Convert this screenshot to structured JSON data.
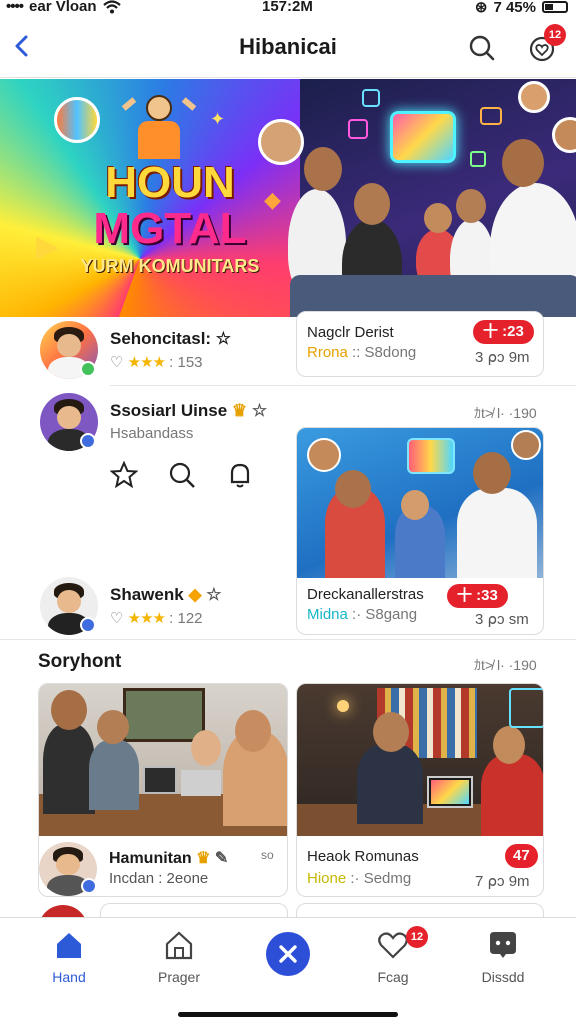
{
  "status_bar": {
    "carrier": "ear Vloan",
    "time": "157:2M",
    "battery": "7 45%"
  },
  "header": {
    "title": "Hibanicai",
    "notification_count": "12"
  },
  "hero": {
    "line1": "HOUN",
    "line2": "MGTAL",
    "line3": "YURM KOMUNITARS"
  },
  "feed": {
    "row1": {
      "name": "Sehoncitasl: ☆",
      "rating_stars": "★★★",
      "rating_value": ": 153",
      "card": {
        "title": "Nagclr Derist",
        "highlight": "Rrona",
        "rest": ":: S8dong",
        "pill": "十 :23",
        "meta": "3 ⍴ɔ 9m"
      }
    },
    "row2": {
      "name": "Ssosiarl Uinse",
      "subtitle": "Hsabandass",
      "time": "ｶt≯ l· ·190",
      "card": {
        "title": "Dreckanallerstras",
        "highlight": "Midna",
        "rest": ":· S8gang",
        "pill": "十 :33",
        "meta": "3 ⍴ɔ ѕm"
      }
    },
    "row3": {
      "name": "Shawenk",
      "rating_stars": "★★★",
      "rating_value": ": 122"
    },
    "section": {
      "title": "Soryhont",
      "time": "ｶt≯ l· ·190"
    },
    "row4": {
      "name": "Hamunitan",
      "extra": "so",
      "subtitle": "Incdan : 2eone",
      "card": {
        "title": "Heaok Romunas",
        "highlight": "Hione",
        "rest": ":· Sedmg",
        "pill": "47",
        "meta": "7 ⍴ɔ 9m"
      }
    }
  },
  "tabs": [
    {
      "label": "Hand"
    },
    {
      "label": "Prager"
    },
    {
      "label": ""
    },
    {
      "label": "Fcag",
      "badge": "12"
    },
    {
      "label": "Dissdd"
    }
  ],
  "colors": {
    "accent": "#2d5bd8",
    "badge": "#e5222b",
    "star": "#f5b400"
  }
}
